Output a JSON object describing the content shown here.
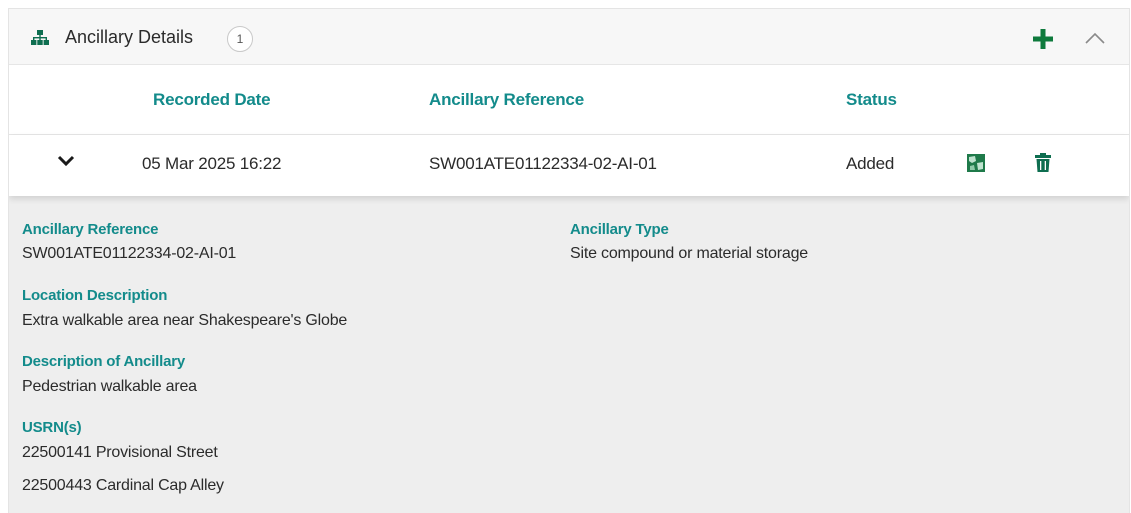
{
  "header": {
    "title": "Ancillary Details",
    "count": "1"
  },
  "table": {
    "columns": [
      "Recorded Date",
      "Ancillary Reference",
      "Status"
    ],
    "rows": [
      {
        "recorded_date": "05 Mar 2025 16:22",
        "ancillary_reference": "SW001ATE01122334-02-AI-01",
        "status": "Added"
      }
    ]
  },
  "details": {
    "ancillary_reference_label": "Ancillary Reference",
    "ancillary_reference_value": "SW001ATE01122334-02-AI-01",
    "ancillary_type_label": "Ancillary Type",
    "ancillary_type_value": "Site compound or material storage",
    "location_description_label": "Location Description",
    "location_description_value": "Extra walkable area near Shakespeare's Globe",
    "description_label": "Description of Ancillary",
    "description_value": "Pedestrian walkable area",
    "usrns_label": "USRN(s)",
    "usrns": [
      "22500141 Provisional Street",
      "22500443 Cardinal Cap Alley"
    ]
  },
  "icons": {
    "header": "hierarchy-icon",
    "add": "plus-icon",
    "collapse": "chevron-up-icon",
    "expand": "chevron-down-icon",
    "map": "map-icon",
    "delete": "trash-icon"
  },
  "colors": {
    "accent": "#138b8b",
    "icon_green": "#0e7a3c",
    "text": "#2b2b2b",
    "details_bg": "#eeeeee"
  }
}
